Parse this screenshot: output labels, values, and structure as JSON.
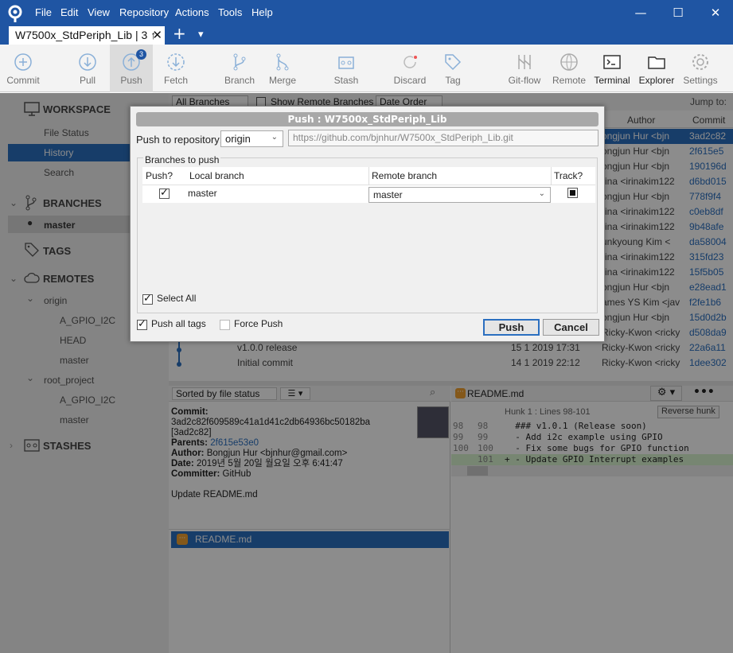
{
  "window": {
    "menu": [
      "File",
      "Edit",
      "View",
      "Repository",
      "Actions",
      "Tools",
      "Help"
    ],
    "tab_title": "W7500x_StdPeriph_Lib | 3 ↑",
    "tab_close": "✕",
    "new_tab": "+",
    "tab_menu": "▾",
    "minimize": "—",
    "maximize": "☐",
    "close": "✕"
  },
  "toolbar": {
    "commit": "Commit",
    "pull": "Pull",
    "push": "Push",
    "push_badge": "3",
    "fetch": "Fetch",
    "branch": "Branch",
    "merge": "Merge",
    "stash": "Stash",
    "discard": "Discard",
    "tag": "Tag",
    "gitflow": "Git-flow",
    "remote": "Remote",
    "terminal": "Terminal",
    "explorer": "Explorer",
    "settings": "Settings"
  },
  "sidebar": {
    "workspace": "WORKSPACE",
    "file_status": "File Status",
    "history": "History",
    "search": "Search",
    "branches": "BRANCHES",
    "master": "master",
    "tags": "TAGS",
    "remotes": "REMOTES",
    "origin": "origin",
    "origin_items": [
      "A_GPIO_I2C",
      "HEAD",
      "master"
    ],
    "root_project": "root_project",
    "root_items": [
      "A_GPIO_I2C",
      "master"
    ],
    "stashes": "STASHES"
  },
  "history_bar": {
    "branches_filter": "All Branches",
    "show_remote": "Show Remote Branches",
    "order": "Date Order",
    "jump_to": "Jump to:"
  },
  "columns": {
    "author": "Author",
    "commit": "Commit"
  },
  "commits": [
    {
      "author": "ongjun Hur <bjn",
      "hash": "3ad2c82"
    },
    {
      "author": "ongjun Hur <bjn",
      "hash": "2f615e5"
    },
    {
      "author": "ongjun Hur <bjn",
      "hash": "190196d"
    },
    {
      "author": "rina <irinakim122",
      "hash": "d6bd015"
    },
    {
      "author": "ongjun Hur <bjn",
      "hash": "778f9f4"
    },
    {
      "author": "rina <irinakim122",
      "hash": "c0eb8df"
    },
    {
      "author": "rina <irinakim122",
      "hash": "9b48afe"
    },
    {
      "author": "unkyoung Kim <",
      "hash": "da58004"
    },
    {
      "author": "rina <irinakim122",
      "hash": "315fd23"
    },
    {
      "author": "rina <irinakim122",
      "hash": "15f5b05"
    },
    {
      "author": "ongjun Hur <bjn",
      "hash": "e28ead1"
    },
    {
      "author": "ames YS Kim <jav",
      "hash": "f2fe1b6"
    },
    {
      "author": "ongjun Hur <bjn",
      "hash": "15d0d2b"
    },
    {
      "author": "Ricky-Kwon <ricky",
      "hash": "d508da9"
    },
    {
      "desc": "v1.0.0 release",
      "date": "15 1 2019 17:31",
      "author": "Ricky-Kwon <ricky",
      "hash": "22a6a11"
    },
    {
      "desc": "Initial commit",
      "date": "14 1 2019 22:12",
      "author": "Ricky-Kwon <ricky",
      "hash": "1dee302"
    }
  ],
  "details": {
    "sort": "Sorted by file status",
    "commit_label": "Commit:",
    "commit_hash": "3ad2c82f609589c41a1d41c2db64936bc50182ba",
    "commit_short": "[3ad2c82]",
    "parents_label": "Parents:",
    "parents": "2f615e53e0",
    "author_label": "Author:",
    "author": "Bongjun Hur <bjnhur@gmail.com>",
    "date_label": "Date:",
    "date": "2019년 5월 20일 월요일 오후 6:41:47",
    "committer_label": "Committer:",
    "committer": "GitHub",
    "message": "Update README.md",
    "file": "README.md"
  },
  "diff": {
    "file": "README.md",
    "hunk": "Hunk 1 : Lines 98-101",
    "reverse": "Reverse hunk",
    "lines": [
      {
        "old": "98",
        "new": "98",
        "text": "  ### v1.0.1 (Release soon)"
      },
      {
        "old": "99",
        "new": "99",
        "text": "  - Add i2c example using GPIO"
      },
      {
        "old": "100",
        "new": "100",
        "text": "  - Fix some bugs for GPIO function"
      },
      {
        "old": "",
        "new": "101",
        "text": "+ - Update GPIO Interrupt examples"
      }
    ]
  },
  "dialog": {
    "title": "Push :  W7500x_StdPeriph_Lib",
    "push_to_label": "Push to repository:",
    "repo": "origin",
    "url": "https://github.com/bjnhur/W7500x_StdPeriph_Lib.git",
    "branches_group": "Branches to push",
    "col_push": "Push?",
    "col_local": "Local branch",
    "col_remote": "Remote branch",
    "col_track": "Track?",
    "rows": [
      {
        "local": "master",
        "remote": "master",
        "push": true,
        "track": true
      }
    ],
    "select_all": "Select All",
    "push_all_tags": "Push all tags",
    "force_push": "Force Push",
    "push_btn": "Push",
    "cancel_btn": "Cancel"
  }
}
